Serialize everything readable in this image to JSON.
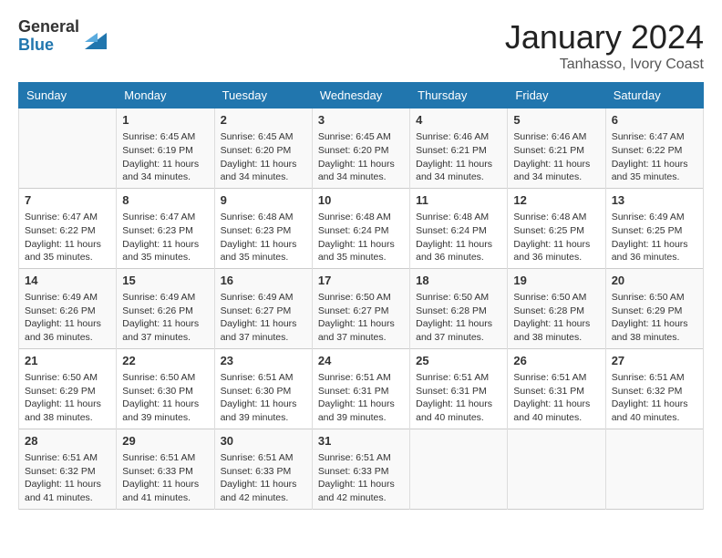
{
  "header": {
    "logo_general": "General",
    "logo_blue": "Blue",
    "main_title": "January 2024",
    "subtitle": "Tanhasso, Ivory Coast"
  },
  "days_of_week": [
    "Sunday",
    "Monday",
    "Tuesday",
    "Wednesday",
    "Thursday",
    "Friday",
    "Saturday"
  ],
  "weeks": [
    [
      {
        "day": "",
        "info": ""
      },
      {
        "day": "1",
        "info": "Sunrise: 6:45 AM\nSunset: 6:19 PM\nDaylight: 11 hours\nand 34 minutes."
      },
      {
        "day": "2",
        "info": "Sunrise: 6:45 AM\nSunset: 6:20 PM\nDaylight: 11 hours\nand 34 minutes."
      },
      {
        "day": "3",
        "info": "Sunrise: 6:45 AM\nSunset: 6:20 PM\nDaylight: 11 hours\nand 34 minutes."
      },
      {
        "day": "4",
        "info": "Sunrise: 6:46 AM\nSunset: 6:21 PM\nDaylight: 11 hours\nand 34 minutes."
      },
      {
        "day": "5",
        "info": "Sunrise: 6:46 AM\nSunset: 6:21 PM\nDaylight: 11 hours\nand 34 minutes."
      },
      {
        "day": "6",
        "info": "Sunrise: 6:47 AM\nSunset: 6:22 PM\nDaylight: 11 hours\nand 35 minutes."
      }
    ],
    [
      {
        "day": "7",
        "info": "Sunrise: 6:47 AM\nSunset: 6:22 PM\nDaylight: 11 hours\nand 35 minutes."
      },
      {
        "day": "8",
        "info": "Sunrise: 6:47 AM\nSunset: 6:23 PM\nDaylight: 11 hours\nand 35 minutes."
      },
      {
        "day": "9",
        "info": "Sunrise: 6:48 AM\nSunset: 6:23 PM\nDaylight: 11 hours\nand 35 minutes."
      },
      {
        "day": "10",
        "info": "Sunrise: 6:48 AM\nSunset: 6:24 PM\nDaylight: 11 hours\nand 35 minutes."
      },
      {
        "day": "11",
        "info": "Sunrise: 6:48 AM\nSunset: 6:24 PM\nDaylight: 11 hours\nand 36 minutes."
      },
      {
        "day": "12",
        "info": "Sunrise: 6:48 AM\nSunset: 6:25 PM\nDaylight: 11 hours\nand 36 minutes."
      },
      {
        "day": "13",
        "info": "Sunrise: 6:49 AM\nSunset: 6:25 PM\nDaylight: 11 hours\nand 36 minutes."
      }
    ],
    [
      {
        "day": "14",
        "info": "Sunrise: 6:49 AM\nSunset: 6:26 PM\nDaylight: 11 hours\nand 36 minutes."
      },
      {
        "day": "15",
        "info": "Sunrise: 6:49 AM\nSunset: 6:26 PM\nDaylight: 11 hours\nand 37 minutes."
      },
      {
        "day": "16",
        "info": "Sunrise: 6:49 AM\nSunset: 6:27 PM\nDaylight: 11 hours\nand 37 minutes."
      },
      {
        "day": "17",
        "info": "Sunrise: 6:50 AM\nSunset: 6:27 PM\nDaylight: 11 hours\nand 37 minutes."
      },
      {
        "day": "18",
        "info": "Sunrise: 6:50 AM\nSunset: 6:28 PM\nDaylight: 11 hours\nand 37 minutes."
      },
      {
        "day": "19",
        "info": "Sunrise: 6:50 AM\nSunset: 6:28 PM\nDaylight: 11 hours\nand 38 minutes."
      },
      {
        "day": "20",
        "info": "Sunrise: 6:50 AM\nSunset: 6:29 PM\nDaylight: 11 hours\nand 38 minutes."
      }
    ],
    [
      {
        "day": "21",
        "info": "Sunrise: 6:50 AM\nSunset: 6:29 PM\nDaylight: 11 hours\nand 38 minutes."
      },
      {
        "day": "22",
        "info": "Sunrise: 6:50 AM\nSunset: 6:30 PM\nDaylight: 11 hours\nand 39 minutes."
      },
      {
        "day": "23",
        "info": "Sunrise: 6:51 AM\nSunset: 6:30 PM\nDaylight: 11 hours\nand 39 minutes."
      },
      {
        "day": "24",
        "info": "Sunrise: 6:51 AM\nSunset: 6:31 PM\nDaylight: 11 hours\nand 39 minutes."
      },
      {
        "day": "25",
        "info": "Sunrise: 6:51 AM\nSunset: 6:31 PM\nDaylight: 11 hours\nand 40 minutes."
      },
      {
        "day": "26",
        "info": "Sunrise: 6:51 AM\nSunset: 6:31 PM\nDaylight: 11 hours\nand 40 minutes."
      },
      {
        "day": "27",
        "info": "Sunrise: 6:51 AM\nSunset: 6:32 PM\nDaylight: 11 hours\nand 40 minutes."
      }
    ],
    [
      {
        "day": "28",
        "info": "Sunrise: 6:51 AM\nSunset: 6:32 PM\nDaylight: 11 hours\nand 41 minutes."
      },
      {
        "day": "29",
        "info": "Sunrise: 6:51 AM\nSunset: 6:33 PM\nDaylight: 11 hours\nand 41 minutes."
      },
      {
        "day": "30",
        "info": "Sunrise: 6:51 AM\nSunset: 6:33 PM\nDaylight: 11 hours\nand 42 minutes."
      },
      {
        "day": "31",
        "info": "Sunrise: 6:51 AM\nSunset: 6:33 PM\nDaylight: 11 hours\nand 42 minutes."
      },
      {
        "day": "",
        "info": ""
      },
      {
        "day": "",
        "info": ""
      },
      {
        "day": "",
        "info": ""
      }
    ]
  ]
}
